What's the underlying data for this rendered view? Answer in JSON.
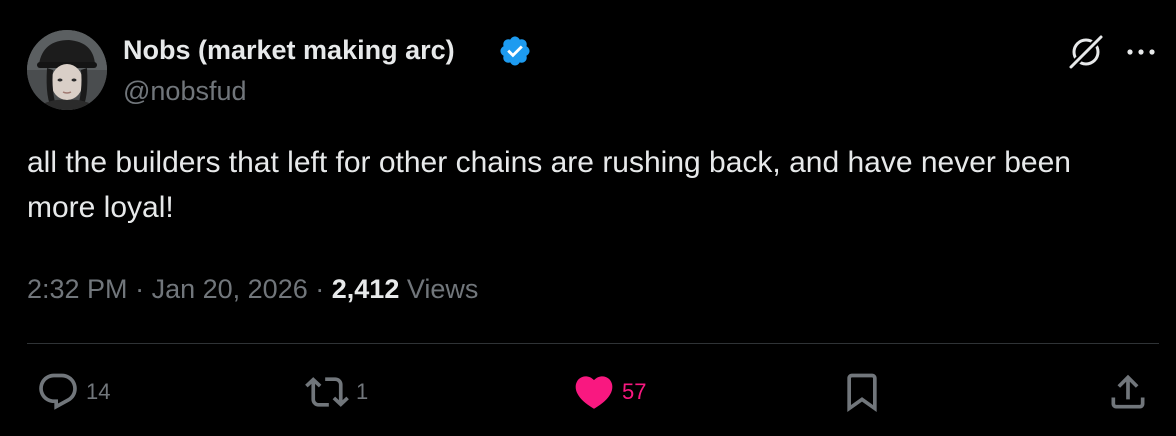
{
  "tweet": {
    "author": {
      "display_name": "Nobs (market making arc)",
      "handle": "@nobsfud",
      "verified": true
    },
    "text": "all the builders that left for other chains are rushing back, and have never been more loyal!",
    "time": "2:32 PM",
    "date": "Jan 20, 2026",
    "separator": "·",
    "views_count": "2,412",
    "views_label": "Views"
  },
  "actions": {
    "reply_count": "14",
    "retweet_count": "1",
    "like_count": "57",
    "liked": true
  },
  "icons": {
    "verified": "verified-badge-icon",
    "grok": "grok-icon",
    "more": "more-icon",
    "reply": "reply-icon",
    "retweet": "retweet-icon",
    "like": "heart-icon",
    "bookmark": "bookmark-icon",
    "share": "share-icon"
  },
  "colors": {
    "background": "#000000",
    "text": "#e7e9ea",
    "secondary": "#71767b",
    "verified": "#1d9bf0",
    "like": "#f91880",
    "divider": "#2f3336"
  }
}
